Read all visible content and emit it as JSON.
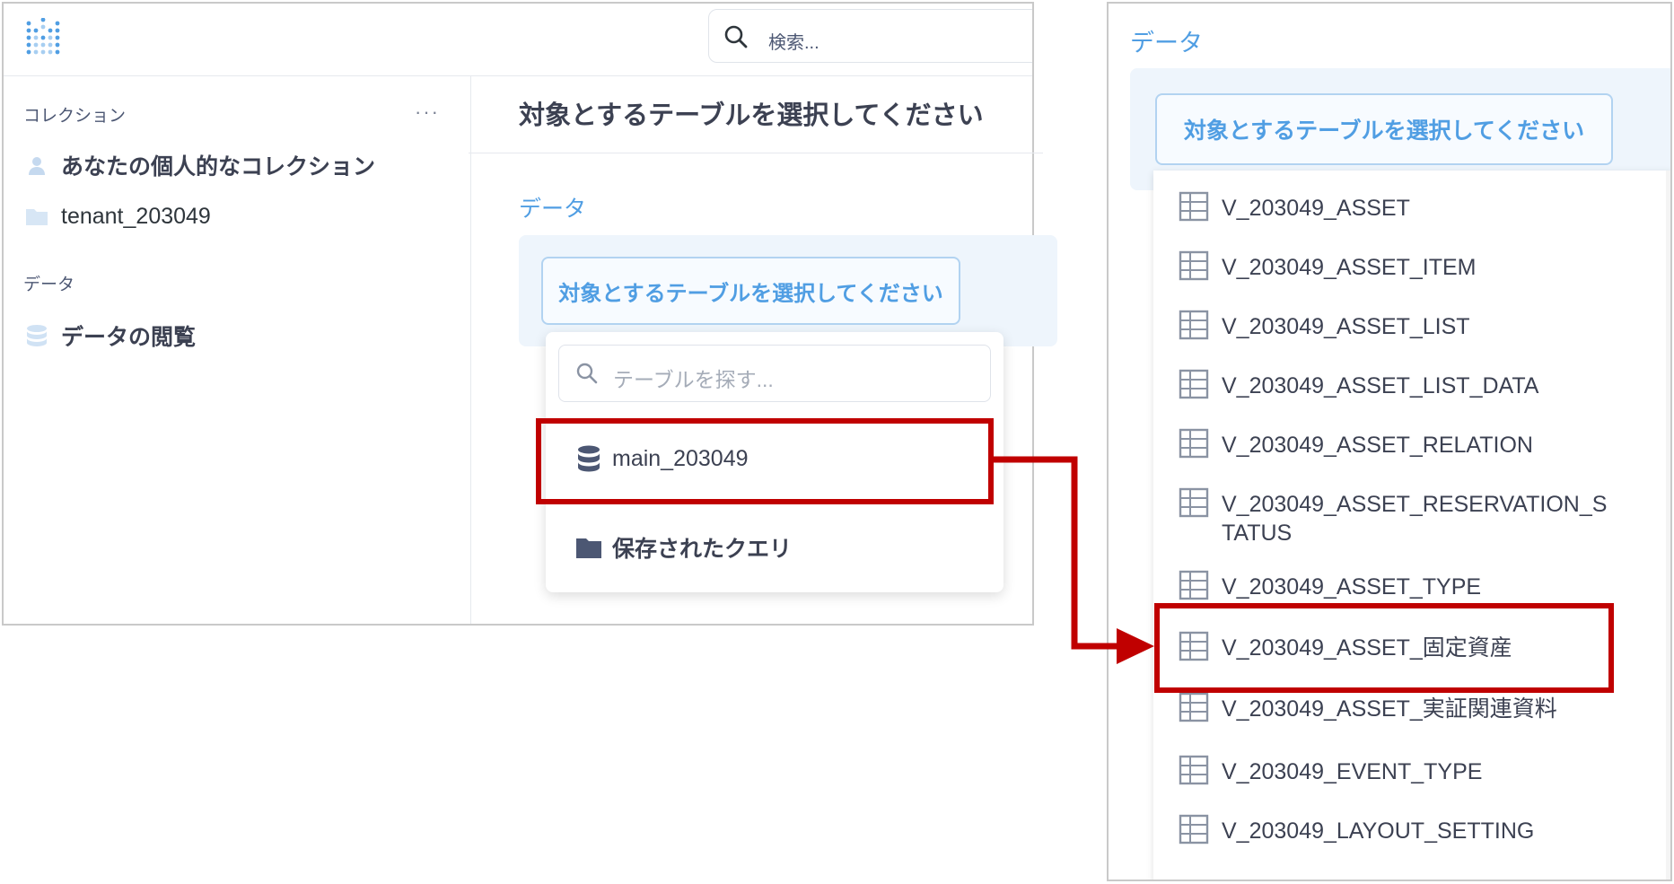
{
  "header": {
    "search_text": "検索..."
  },
  "sidebar": {
    "collections_heading": "コレクション",
    "more_label": "···",
    "items": [
      {
        "label": "あなたの個人的なコレクション"
      },
      {
        "label": "tenant_203049"
      }
    ],
    "data_heading": "データ",
    "browse_label": "データの閲覧"
  },
  "main": {
    "title": "対象とするテーブルを選択してください",
    "data_label": "データ",
    "select_button": "対象とするテーブルを選択してください",
    "popover": {
      "search_placeholder": "テーブルを探す...",
      "database_item": "main_203049",
      "saved_questions": "保存されたクエリ"
    }
  },
  "zoom_panel": {
    "data_label": "データ",
    "select_button": "対象とするテーブルを選択してください",
    "tables": [
      "V_203049_ASSET",
      "V_203049_ASSET_ITEM",
      "V_203049_ASSET_LIST",
      "V_203049_ASSET_LIST_DATA",
      "V_203049_ASSET_RELATION",
      "V_203049_ASSET_RESERVATION_STATUS",
      "V_203049_ASSET_TYPE",
      "V_203049_ASSET_固定資産",
      "V_203049_ASSET_実証関連資料",
      "V_203049_EVENT_TYPE",
      "V_203049_LAYOUT_SETTING"
    ]
  },
  "colors": {
    "brand": "#509ee3",
    "highlight": "#c00000",
    "text": "#3c4152"
  }
}
